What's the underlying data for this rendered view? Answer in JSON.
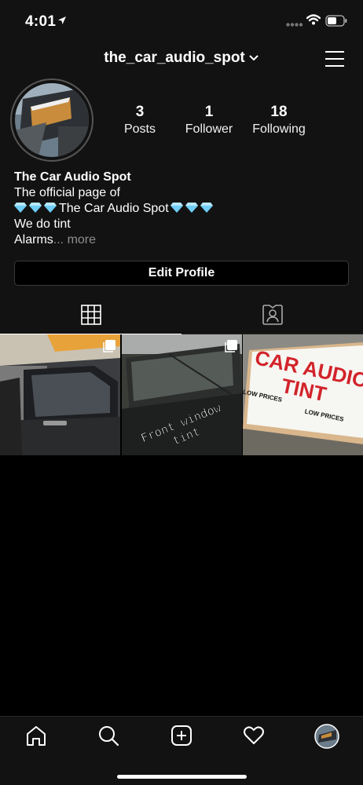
{
  "status_bar": {
    "time": "4:01",
    "location_icon": "location-arrow-icon",
    "signal_icon": "cellular-signal-icon",
    "wifi_icon": "wifi-icon",
    "battery_icon": "battery-icon"
  },
  "header": {
    "username": "the_car_audio_spot",
    "dropdown_icon": "chevron-down-icon",
    "menu_icon": "hamburger-menu-icon"
  },
  "profile": {
    "avatar_icon": "profile-avatar",
    "stats": {
      "posts_count": "3",
      "posts_label": "Posts",
      "followers_count": "1",
      "followers_label": "Follower",
      "following_count": "18",
      "following_label": "Following"
    },
    "bio": {
      "name": "The Car Audio Spot",
      "line1": "The official page of",
      "line2_text": "The Car Audio Spot",
      "line2_gem": "💎",
      "line3": "We do tint",
      "line4": "Alarms",
      "ellipsis": "...",
      "more": "more"
    },
    "edit_button": "Edit Profile"
  },
  "tabs": [
    {
      "name": "posts-grid",
      "icon": "grid-icon",
      "active": true
    },
    {
      "name": "tagged",
      "icon": "tagged-person-icon",
      "active": false
    }
  ],
  "posts": [
    {
      "caption": "",
      "multi": true
    },
    {
      "caption_line1": "Front window",
      "caption_line2": "tint",
      "multi": true
    },
    {
      "sign_line1": "CAR AUDIO",
      "sign_line2": "TINT",
      "sign_small1": "LOW PRICES",
      "sign_small2": "LOW PRICES",
      "multi": false
    }
  ],
  "bottom_nav": [
    {
      "name": "home",
      "icon": "home-icon"
    },
    {
      "name": "search",
      "icon": "search-icon"
    },
    {
      "name": "new-post",
      "icon": "plus-square-icon"
    },
    {
      "name": "activity",
      "icon": "heart-icon"
    },
    {
      "name": "profile",
      "icon": "profile-avatar-icon"
    }
  ],
  "colors": {
    "background": "#000000",
    "surface": "#121212",
    "text": "#ffffff",
    "muted": "#8e8e8e",
    "border": "#3a3a3a",
    "gem": "#5ec4f0",
    "sign_red": "#d2232a"
  }
}
